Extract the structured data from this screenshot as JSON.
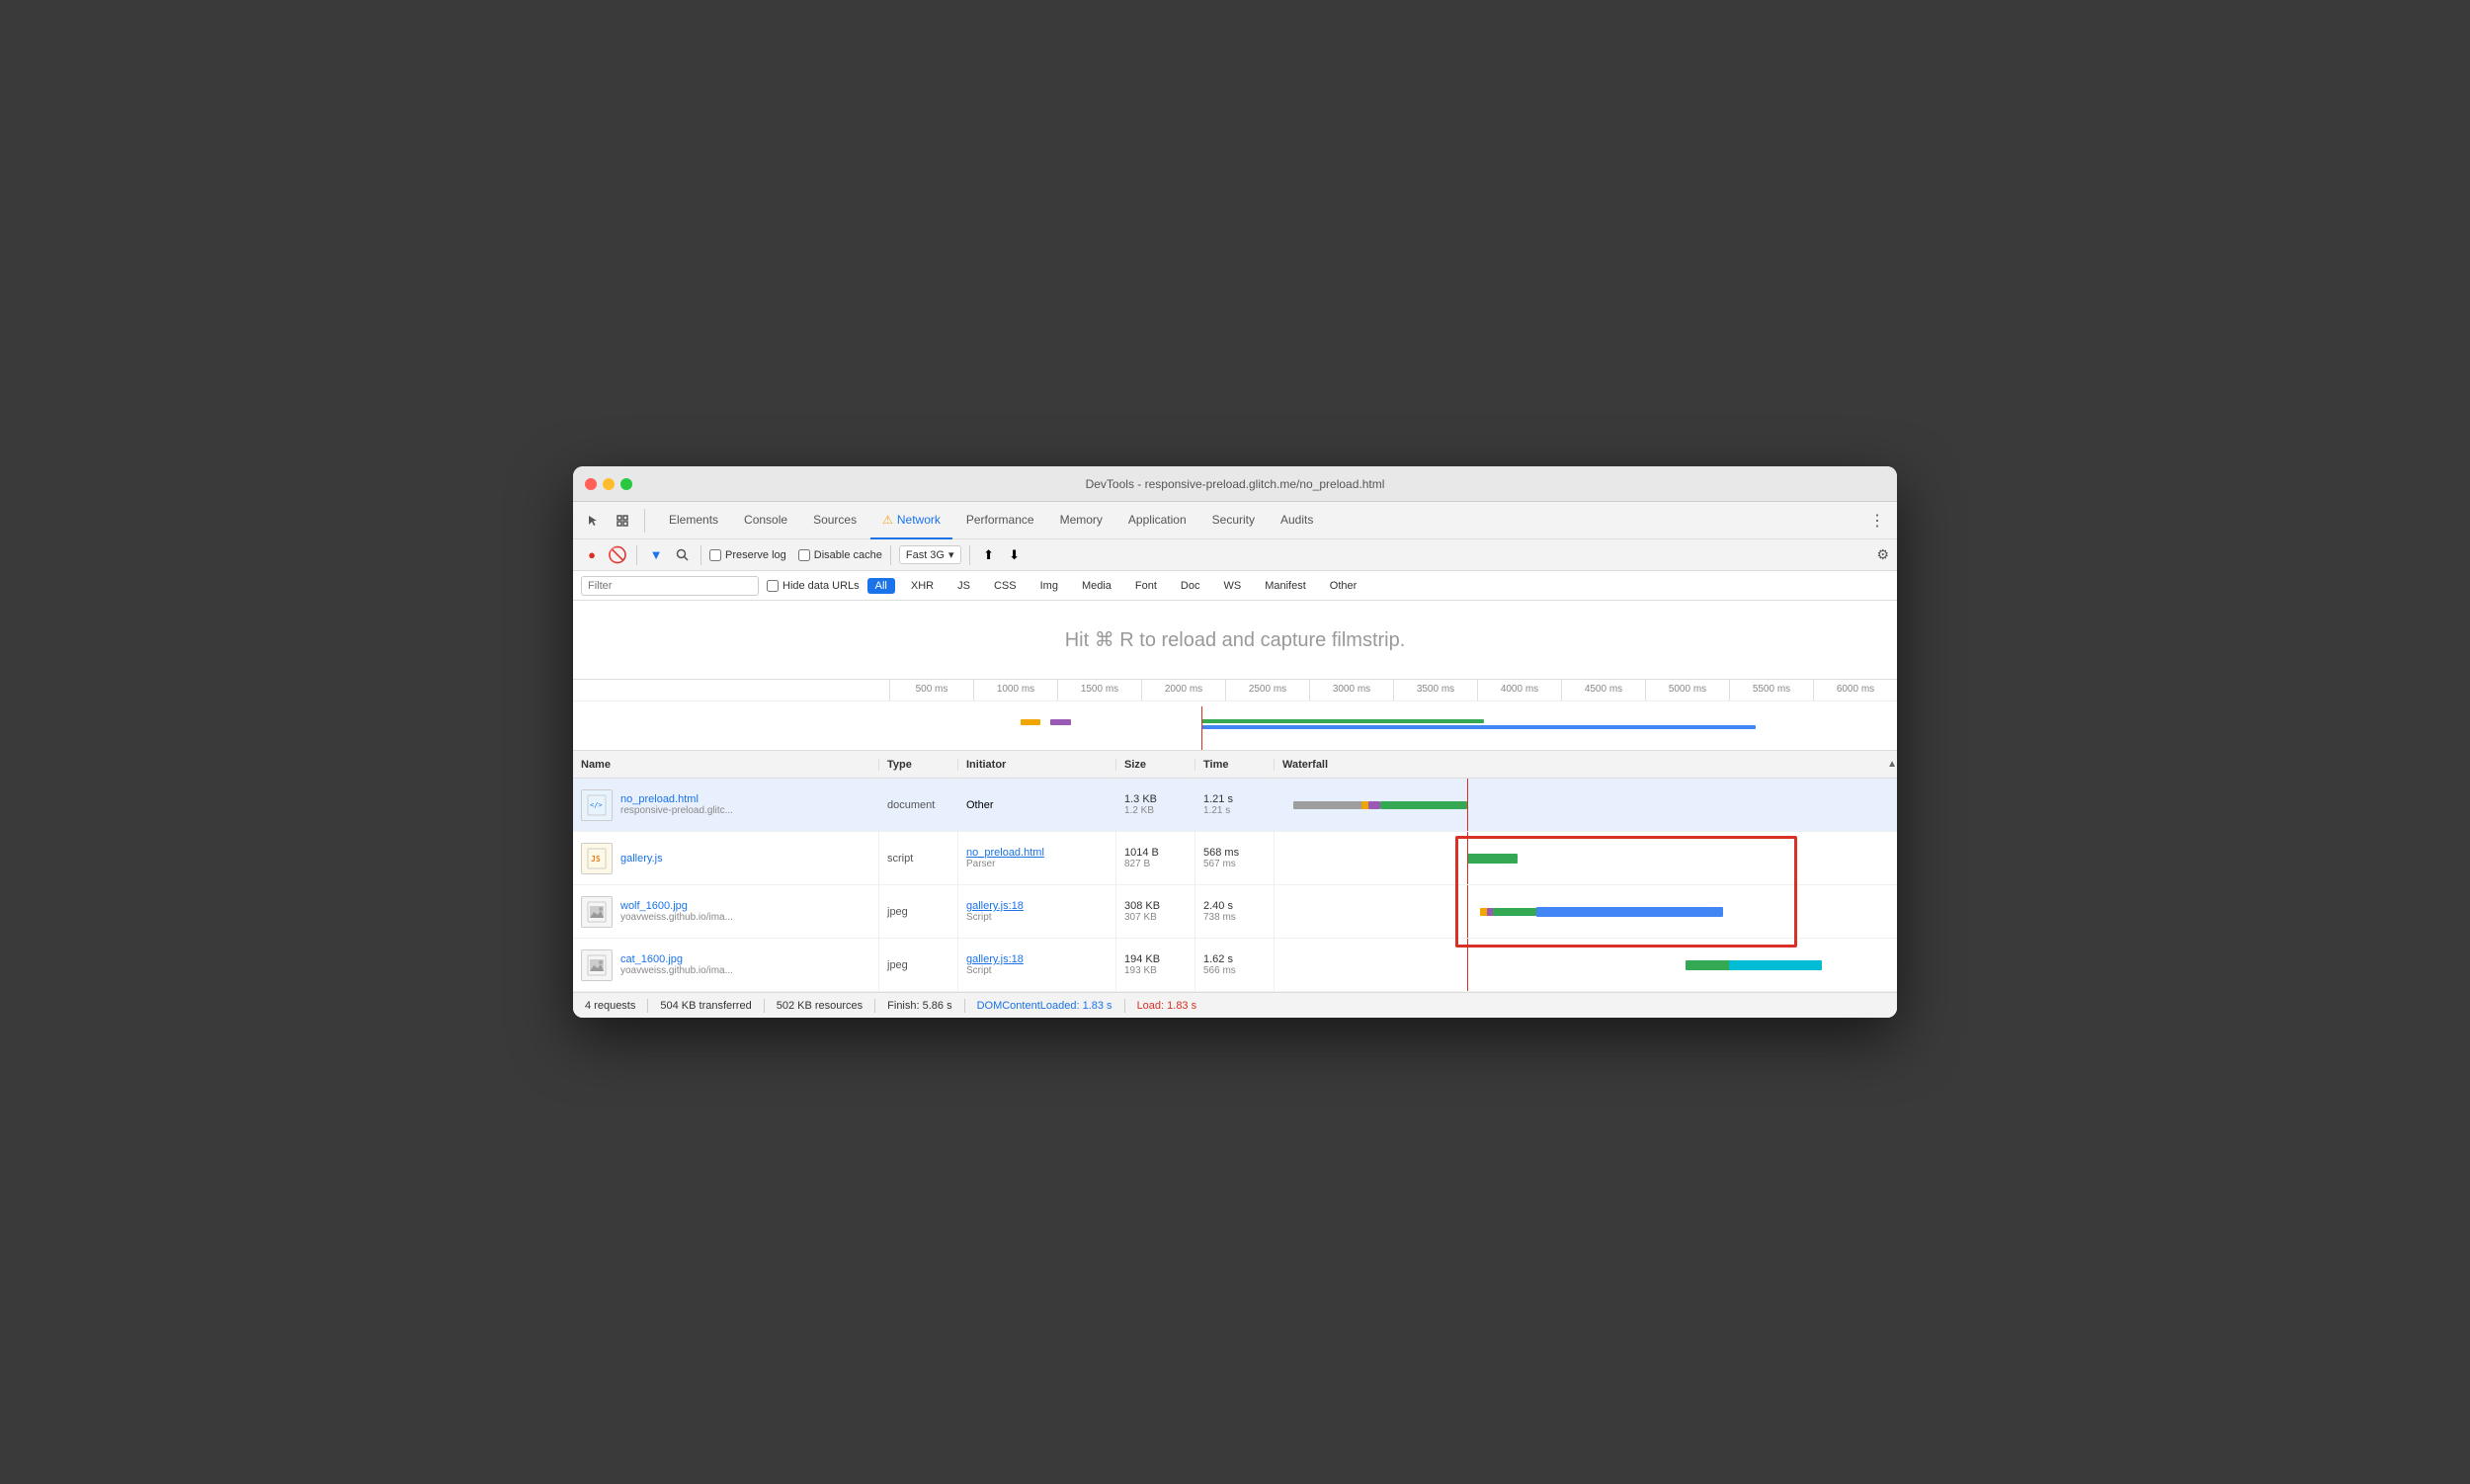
{
  "window": {
    "title": "DevTools - responsive-preload.glitch.me/no_preload.html"
  },
  "tabs": [
    {
      "id": "elements",
      "label": "Elements",
      "active": false
    },
    {
      "id": "console",
      "label": "Console",
      "active": false
    },
    {
      "id": "sources",
      "label": "Sources",
      "active": false
    },
    {
      "id": "network",
      "label": "Network",
      "active": true,
      "warning": true
    },
    {
      "id": "performance",
      "label": "Performance",
      "active": false
    },
    {
      "id": "memory",
      "label": "Memory",
      "active": false
    },
    {
      "id": "application",
      "label": "Application",
      "active": false
    },
    {
      "id": "security",
      "label": "Security",
      "active": false
    },
    {
      "id": "audits",
      "label": "Audits",
      "active": false
    }
  ],
  "toolbar": {
    "preserve_log": "Preserve log",
    "disable_cache": "Disable cache",
    "throttle": "Fast 3G"
  },
  "filter": {
    "placeholder": "Filter",
    "hide_data_urls": "Hide data URLs",
    "types": [
      "All",
      "XHR",
      "JS",
      "CSS",
      "Img",
      "Media",
      "Font",
      "Doc",
      "WS",
      "Manifest",
      "Other"
    ]
  },
  "filmstrip": {
    "hint": "Hit ⌘ R to reload and capture filmstrip."
  },
  "ruler": {
    "ticks": [
      "500 ms",
      "1000 ms",
      "1500 ms",
      "2000 ms",
      "2500 ms",
      "3000 ms",
      "3500 ms",
      "4000 ms",
      "4500 ms",
      "5000 ms",
      "5500 ms",
      "6000 ms"
    ]
  },
  "table": {
    "headers": {
      "name": "Name",
      "type": "Type",
      "initiator": "Initiator",
      "size": "Size",
      "time": "Time",
      "waterfall": "Waterfall"
    },
    "rows": [
      {
        "name": "no_preload.html",
        "url": "responsive-preload.glitc...",
        "type": "document",
        "initiator": "Other",
        "initiator_sub": "",
        "initiator_link": false,
        "size1": "1.3 KB",
        "size2": "1.2 KB",
        "time1": "1.21 s",
        "time2": "1.21 s",
        "icon": "html",
        "selected": true
      },
      {
        "name": "gallery.js",
        "url": "",
        "type": "script",
        "initiator": "no_preload.html",
        "initiator_sub": "Parser",
        "initiator_link": true,
        "size1": "1014 B",
        "size2": "827 B",
        "time1": "568 ms",
        "time2": "567 ms",
        "icon": "js",
        "selected": false
      },
      {
        "name": "wolf_1600.jpg",
        "url": "yoavweiss.github.io/ima...",
        "type": "jpeg",
        "initiator": "gallery.js:18",
        "initiator_sub": "Script",
        "initiator_link": true,
        "size1": "308 KB",
        "size2": "307 KB",
        "time1": "2.40 s",
        "time2": "738 ms",
        "icon": "img",
        "selected": false
      },
      {
        "name": "cat_1600.jpg",
        "url": "yoavweiss.github.io/ima...",
        "type": "jpeg",
        "initiator": "gallery.js:18",
        "initiator_sub": "Script",
        "initiator_link": true,
        "size1": "194 KB",
        "size2": "193 KB",
        "time1": "1.62 s",
        "time2": "566 ms",
        "icon": "img",
        "selected": false
      }
    ]
  },
  "status": {
    "requests": "4 requests",
    "transferred": "504 KB transferred",
    "resources": "502 KB resources",
    "finish": "Finish: 5.86 s",
    "dom_loaded": "DOMContentLoaded: 1.83 s",
    "load": "Load: 1.83 s"
  }
}
